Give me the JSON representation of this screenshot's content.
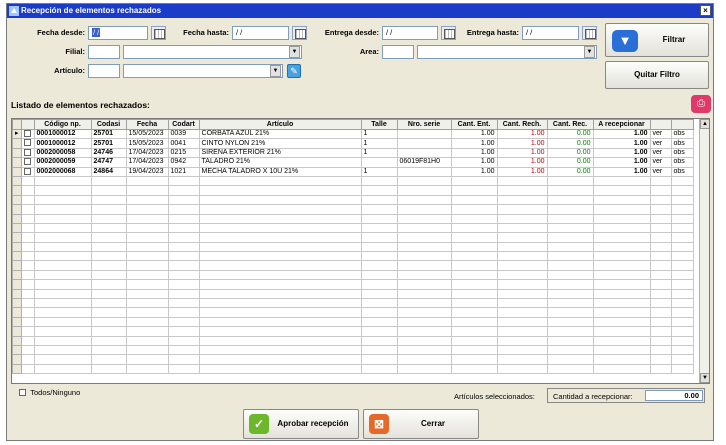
{
  "window": {
    "title": "Recepción de elementos rechazados",
    "close_symbol": "×"
  },
  "filters": {
    "fecha_desde_label": "Fecha desde:",
    "fecha_desde_value": "/ /",
    "fecha_hasta_label": "Fecha hasta:",
    "fecha_hasta_value": "/ /",
    "entrega_desde_label": "Entrega desde:",
    "entrega_desde_value": "/ /",
    "entrega_hasta_label": "Entrega hasta:",
    "entrega_hasta_value": "/ /",
    "filial_label": "Filial:",
    "area_label": "Area:",
    "articulo_label": "Artículo:",
    "filtrar_label": "Filtrar",
    "quitar_filtro_label": "Quitar Filtro"
  },
  "list": {
    "title": "Listado de elementos rechazados:",
    "columns": [
      "",
      "",
      "Código np.",
      "Codasi",
      "Fecha",
      "Codart",
      "Artículo",
      "Talle",
      "Nro. serie",
      "Cant. Ent.",
      "Cant. Rech.",
      "Cant. Rec.",
      "A recepcionar",
      "",
      ""
    ],
    "rows": [
      {
        "marker": "▸",
        "codigo": "0001000012",
        "codasi": "25701",
        "fecha": "15/05/2023",
        "codart": "0039",
        "articulo": "CORBATA AZUL 21%",
        "talle": "1",
        "serie": "",
        "ent": "1.00",
        "rech": "1.00",
        "rec": "0.00",
        "arec": "1.00",
        "ver": "ver",
        "obs": "obs"
      },
      {
        "marker": "",
        "codigo": "0001000012",
        "codasi": "25701",
        "fecha": "15/05/2023",
        "codart": "0041",
        "articulo": "CINTO NYLON 21%",
        "talle": "1",
        "serie": "",
        "ent": "1.00",
        "rech": "1.00",
        "rec": "0.00",
        "arec": "1.00",
        "ver": "ver",
        "obs": "obs"
      },
      {
        "marker": "",
        "codigo": "0002000058",
        "codasi": "24746",
        "fecha": "17/04/2023",
        "codart": "0215",
        "articulo": "SIRENA EXTERIOR 21%",
        "talle": "1",
        "serie": "",
        "ent": "1.00",
        "rech": "1.00",
        "rec": "0.00",
        "arec": "1.00",
        "ver": "ver",
        "obs": "obs"
      },
      {
        "marker": "",
        "codigo": "0002000059",
        "codasi": "24747",
        "fecha": "17/04/2023",
        "codart": "0942",
        "articulo": "TALADRO 21%",
        "talle": "",
        "serie": "06019F81H0",
        "ent": "1.00",
        "rech": "1.00",
        "rec": "0.00",
        "arec": "1.00",
        "ver": "ver",
        "obs": "obs"
      },
      {
        "marker": "",
        "codigo": "0002000068",
        "codasi": "24864",
        "fecha": "19/04/2023",
        "codart": "1021",
        "articulo": "MECHA TALADRO X 10U 21%",
        "talle": "1",
        "serie": "",
        "ent": "1.00",
        "rech": "1.00",
        "rec": "0.00",
        "arec": "1.00",
        "ver": "ver",
        "obs": "obs"
      }
    ]
  },
  "footer": {
    "todos_label": "Todos/Ninguno",
    "seleccionados_label": "Artículos seleccionados:",
    "cantidad_label": "Cantidad a recepcionar:",
    "cantidad_value": "0.00",
    "aprobar_label": "Aprobar recepción",
    "cerrar_label": "Cerrar"
  }
}
